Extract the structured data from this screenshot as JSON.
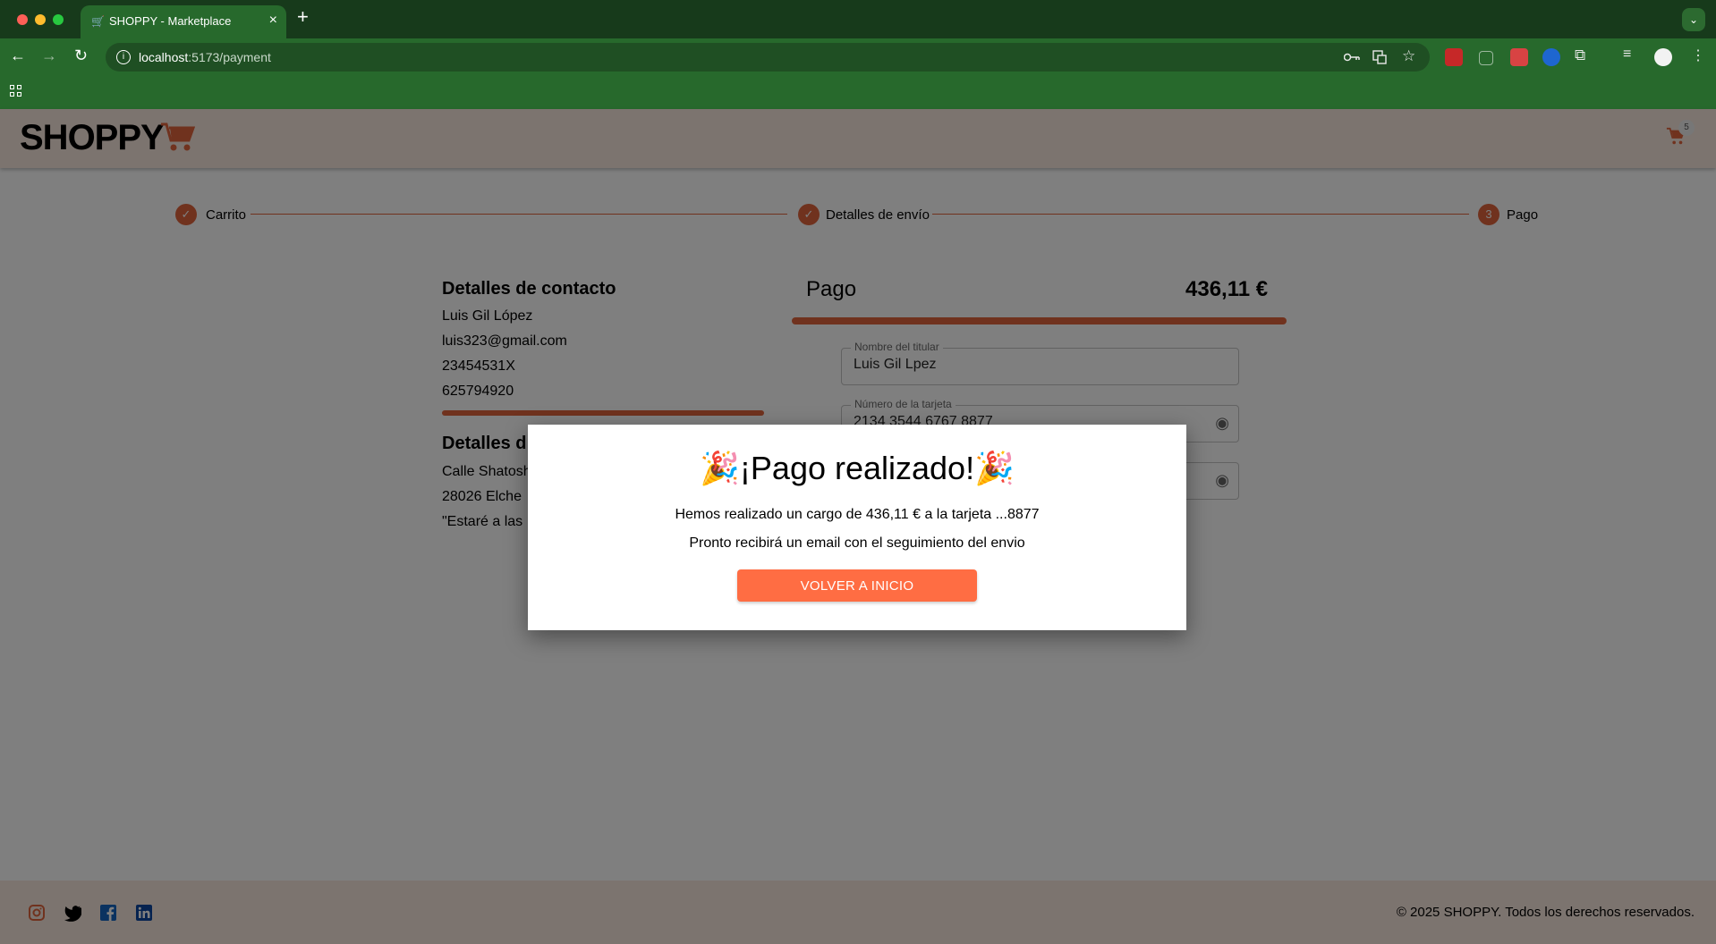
{
  "browser": {
    "tab_title": "SHOPPY - Marketplace",
    "tab_close": "×",
    "new_tab": "+",
    "tab_list": "⌄",
    "url_host": "localhost",
    "url_path": ":5173/payment",
    "nav": {
      "back": "←",
      "forward": "→",
      "reload": "↻"
    }
  },
  "header": {
    "logo_text": "SHOPPY",
    "cart_count": "5"
  },
  "stepper": {
    "steps": [
      {
        "label": "Carrito",
        "state": "done",
        "marker": "✓"
      },
      {
        "label": "Detalles de envío",
        "state": "done",
        "marker": "✓"
      },
      {
        "label": "Pago",
        "state": "active",
        "marker": "3"
      }
    ]
  },
  "contact": {
    "title": "Detalles de contacto",
    "name": "Luis Gil López",
    "email": "luis323@gmail.com",
    "dni": "23454531X",
    "phone": "625794920"
  },
  "shipping": {
    "title": "Detalles d",
    "street": "Calle Shatosh",
    "city": "28026 Elche",
    "note": "\"Estaré a las"
  },
  "payment": {
    "title": "Pago",
    "amount": "436,11 €",
    "holder_label": "Nombre del titular",
    "holder_value": "Luis Gil Lpez",
    "card_label": "Número de la tarjeta",
    "card_value": "2134 3544 6767 8877"
  },
  "modal": {
    "title": "🎉¡Pago realizado!🎉",
    "line1": "Hemos realizado un cargo de 436,11 € a la tarjeta ...8877",
    "line2": "Pronto recibirá un email con el seguimiento del envio",
    "button": "VOLVER A INICIO"
  },
  "footer": {
    "copyright": "© 2025 SHOPPY. Todos los derechos reservados.",
    "social": [
      "instagram-icon",
      "twitter-icon",
      "facebook-icon",
      "linkedin-icon"
    ]
  },
  "colors": {
    "accent": "#e0643c",
    "button": "#ff6d43",
    "header_bg": "#f9e9df",
    "chrome_bg": "#27692c"
  }
}
